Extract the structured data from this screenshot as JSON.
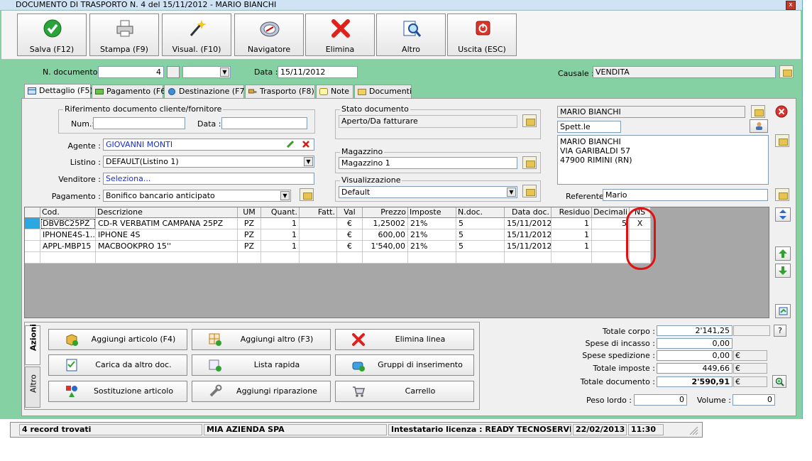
{
  "window": {
    "title": "DOCUMENTO DI TRASPORTO N. 4 del 15/11/2012 - MARIO BIANCHI",
    "close_label": "x"
  },
  "toolbar": [
    {
      "label": "Salva (F12)",
      "icon": "check-icon"
    },
    {
      "label": "Stampa (F9)",
      "icon": "printer-icon"
    },
    {
      "label": "Visual. (F10)",
      "icon": "magic-wand-icon"
    },
    {
      "label": "Navigatore",
      "icon": "compass-icon"
    },
    {
      "label": "Elimina",
      "icon": "delete-x-icon"
    },
    {
      "label": "Altro",
      "icon": "search-document-icon"
    },
    {
      "label": "Uscita (ESC)",
      "icon": "power-icon"
    }
  ],
  "header": {
    "ndoc_label": "N. documento :",
    "ndoc_value": "4",
    "data_label": "Data :",
    "data_value": "15/11/2012",
    "causale_label": "Causale :",
    "causale_value": "VENDITA"
  },
  "tabs": [
    "Dettaglio (F5)",
    "Pagamento (F6)",
    "Destinazione (F7)",
    "Trasporto (F8)",
    "Note",
    "Documenti"
  ],
  "riferimento": {
    "title": "Riferimento documento cliente/fornitore",
    "num_label": "Num.:",
    "data_label": "Data :"
  },
  "fields": {
    "agente_label": "Agente :",
    "agente_value": "GIOVANNI MONTI",
    "listino_label": "Listino :",
    "listino_value": "DEFAULT(Listino 1)",
    "venditore_label": "Venditore :",
    "venditore_value": "Seleziona...",
    "pagamento_label": "Pagamento :",
    "pagamento_value": "Bonifico bancario anticipato"
  },
  "stato": {
    "title": "Stato documento",
    "value": "Aperto/Da fatturare"
  },
  "magazzino": {
    "title": "Magazzino",
    "value": "Magazzino 1"
  },
  "visualizzazione": {
    "title": "Visualizzazione",
    "value": "Default"
  },
  "cliente": {
    "name": "MARIO BIANCHI",
    "prefix": "Spett.le",
    "address": [
      "MARIO BIANCHI",
      "VIA GARIBALDI 57",
      "47900 RIMINI (RN)"
    ],
    "referente_label": "Referente",
    "referente_value": "Mario"
  },
  "grid": {
    "headers": [
      "Cod.",
      "Descrizione",
      "UM",
      "Quant.",
      "Fatt.",
      "Val",
      "Prezzo",
      "Imposte",
      "N.doc.",
      "Data doc.",
      "Residuo",
      "Decimali",
      "NS"
    ],
    "rows": [
      [
        "DBVBC25PZ",
        "CD-R VERBATIM CAMPANA 25PZ",
        "PZ",
        "1",
        "",
        "€",
        "1,25002",
        "21%",
        "5",
        "15/11/2012",
        "1",
        "5",
        "X"
      ],
      [
        "IPHONE4S-1...",
        "IPHONE 4S",
        "PZ",
        "1",
        "",
        "€",
        "600,00",
        "21%",
        "5",
        "15/11/2012",
        "1",
        "",
        ""
      ],
      [
        "APPL-MBP15",
        "MACBOOKPRO 15''",
        "PZ",
        "1",
        "",
        "€",
        "1'540,00",
        "21%",
        "5",
        "15/11/2012",
        "1",
        "",
        ""
      ]
    ]
  },
  "actions": {
    "tab_azioni": "Azioni",
    "tab_altro": "Altro",
    "buttons": [
      [
        "Aggiungi articolo (F4)",
        "Aggiungi altro (F3)",
        "Elimina linea"
      ],
      [
        "Carica da altro doc.",
        "Lista rapida",
        "Gruppi di inserimento"
      ],
      [
        "Sostituzione articolo",
        "Aggiungi riparazione",
        "Carrello"
      ]
    ]
  },
  "totals": {
    "totale_corpo_label": "Totale corpo :",
    "totale_corpo": "2'141,25",
    "help": "?",
    "spese_incasso_label": "Spese di incasso :",
    "spese_incasso": "0,00",
    "spese_spedizione_label": "Spese spedizione :",
    "spese_spedizione": "0,00",
    "totale_imposte_label": "Totale imposte :",
    "totale_imposte": "449,66",
    "totale_documento_label": "Totale documento :",
    "totale_documento": "2'590,91",
    "currency": "€",
    "peso_label": "Peso lordo :",
    "peso": "0",
    "volume_label": "Volume :",
    "volume": "0"
  },
  "status": {
    "records": "4 record trovati",
    "company": "MIA AZIENDA SPA",
    "license": "Intestatario licenza : READY TECNOSERVIC",
    "date": "22/02/2013",
    "time": "11:30"
  },
  "colors": {
    "window_bg": "#86d1a4",
    "highlight": "#e01010",
    "link": "#1a2fd0"
  }
}
